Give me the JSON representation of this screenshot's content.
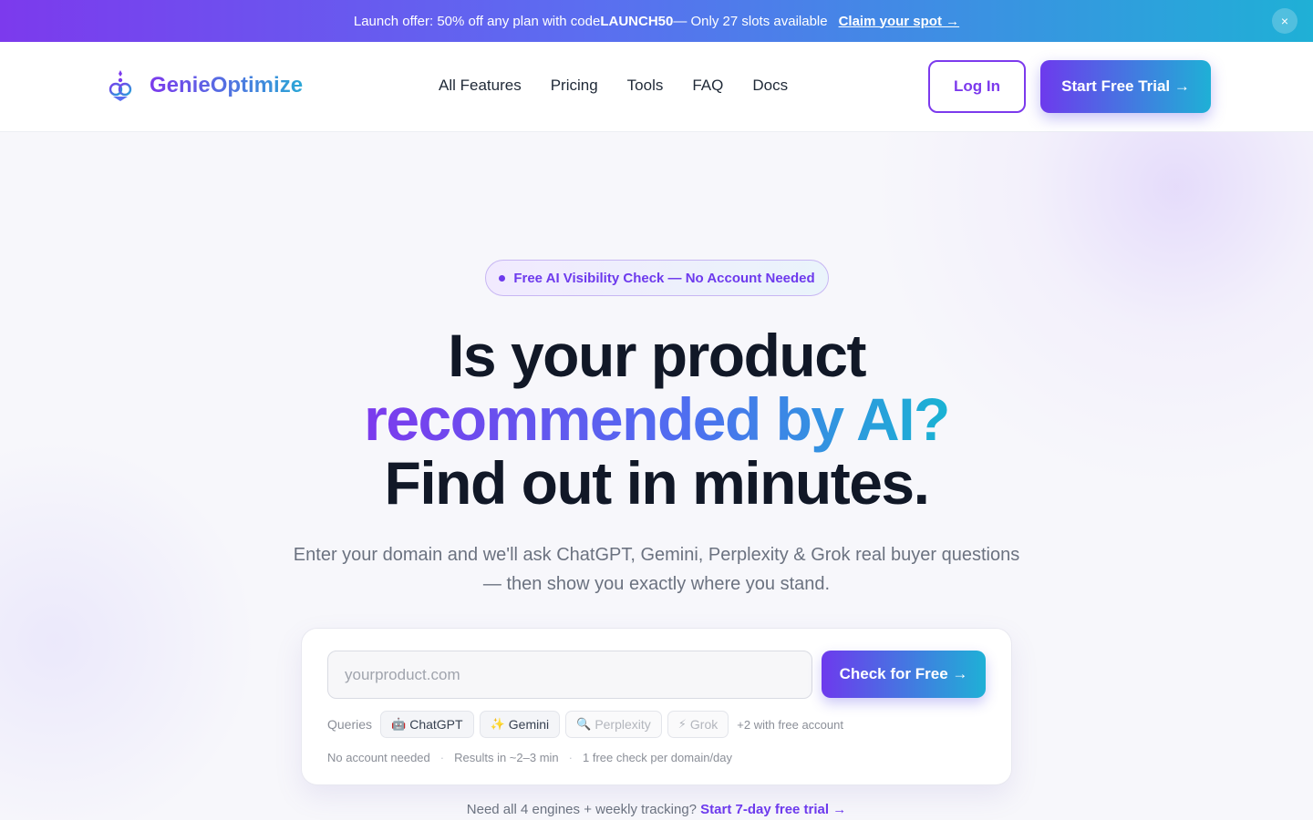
{
  "announcement": {
    "text_before": "Launch offer: 50% off any plan with code ",
    "code": "LAUNCH50",
    "text_after": " — Only 27 slots available",
    "claim_link": "Claim your spot →",
    "close_icon": "close-icon",
    "close_glyph": "×"
  },
  "header": {
    "brand": "GenieOptimize",
    "logo_icon": "genie-lamp-logo-icon",
    "nav": [
      "All Features",
      "Pricing",
      "Tools",
      "FAQ",
      "Docs"
    ],
    "login_label": "Log In",
    "trial_label": "Start Free Trial →"
  },
  "hero": {
    "badge": "Free AI Visibility Check — No Account Needed",
    "headline_line1": "Is your product",
    "headline_line2": "recommended by AI?",
    "headline_line3": "Find out in minutes.",
    "subtitle": "Enter your domain and we'll ask ChatGPT, Gemini, Perplexity & Grok real buyer questions — then show you exactly where you stand."
  },
  "form": {
    "input_value": "",
    "input_placeholder": "yourproduct.com",
    "check_label": "Check for Free →",
    "queries_label": "Queries",
    "engines": [
      {
        "icon": "🤖",
        "icon_name": "robot-icon",
        "label": "ChatGPT",
        "enabled": true
      },
      {
        "icon": "✨",
        "icon_name": "sparkles-icon",
        "label": "Gemini",
        "enabled": true
      },
      {
        "icon": "🔍",
        "icon_name": "magnifier-icon",
        "label": "Perplexity",
        "enabled": false
      },
      {
        "icon": "⚡",
        "icon_name": "lightning-icon",
        "label": "Grok",
        "enabled": false
      }
    ],
    "engines_more": "+2 with free account",
    "meta": [
      "No account needed",
      "Results in ~2–3 min",
      "1 free check per domain/day"
    ],
    "meta_separator": "·"
  },
  "footer_cta": {
    "text": "Need all 4 engines + weekly tracking? ",
    "link": "Start 7-day free trial →"
  },
  "colors": {
    "accent_purple": "#6d3aed",
    "accent_cyan": "#1fb0d6",
    "heading": "#111827",
    "muted": "#6b7280"
  }
}
